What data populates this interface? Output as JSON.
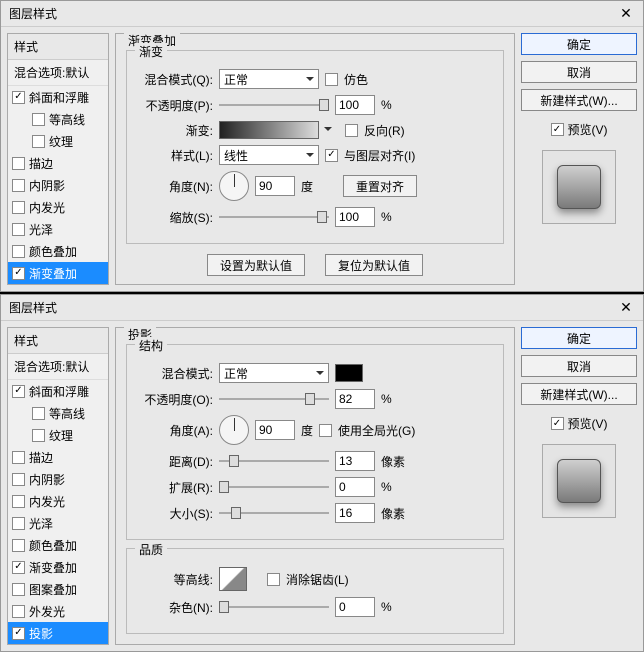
{
  "dialogs": [
    {
      "title": "图层样式",
      "styles_header": "样式",
      "blend_default": "混合选项:默认",
      "style_items": [
        {
          "label": "斜面和浮雕",
          "checked": true,
          "selected": false,
          "indent": false
        },
        {
          "label": "等高线",
          "checked": false,
          "selected": false,
          "indent": true
        },
        {
          "label": "纹理",
          "checked": false,
          "selected": false,
          "indent": true
        },
        {
          "label": "描边",
          "checked": false,
          "selected": false,
          "indent": false
        },
        {
          "label": "内阴影",
          "checked": false,
          "selected": false,
          "indent": false
        },
        {
          "label": "内发光",
          "checked": false,
          "selected": false,
          "indent": false
        },
        {
          "label": "光泽",
          "checked": false,
          "selected": false,
          "indent": false
        },
        {
          "label": "颜色叠加",
          "checked": false,
          "selected": false,
          "indent": false
        },
        {
          "label": "渐变叠加",
          "checked": true,
          "selected": true,
          "indent": false
        }
      ],
      "panel_title": "渐变叠加",
      "sub_title": "渐变",
      "blend_mode_label": "混合模式(Q):",
      "blend_mode_value": "正常",
      "dither_label": "仿色",
      "opacity_label": "不透明度(P):",
      "opacity_value": "100",
      "pct": "%",
      "gradient_label": "渐变:",
      "reverse_label": "反向(R)",
      "style_label": "样式(L):",
      "style_value": "线性",
      "align_label": "与图层对齐(I)",
      "angle_label": "角度(N):",
      "angle_value": "90",
      "deg": "度",
      "reset_align": "重置对齐",
      "scale_label": "缩放(S):",
      "scale_value": "100",
      "set_default": "设置为默认值",
      "reset_default": "复位为默认值",
      "ok": "确定",
      "cancel": "取消",
      "new_style": "新建样式(W)...",
      "preview_label": "预览(V)"
    },
    {
      "title": "图层样式",
      "styles_header": "样式",
      "blend_default": "混合选项:默认",
      "style_items": [
        {
          "label": "斜面和浮雕",
          "checked": true,
          "selected": false,
          "indent": false
        },
        {
          "label": "等高线",
          "checked": false,
          "selected": false,
          "indent": true
        },
        {
          "label": "纹理",
          "checked": false,
          "selected": false,
          "indent": true
        },
        {
          "label": "描边",
          "checked": false,
          "selected": false,
          "indent": false
        },
        {
          "label": "内阴影",
          "checked": false,
          "selected": false,
          "indent": false
        },
        {
          "label": "内发光",
          "checked": false,
          "selected": false,
          "indent": false
        },
        {
          "label": "光泽",
          "checked": false,
          "selected": false,
          "indent": false
        },
        {
          "label": "颜色叠加",
          "checked": false,
          "selected": false,
          "indent": false
        },
        {
          "label": "渐变叠加",
          "checked": true,
          "selected": false,
          "indent": false
        },
        {
          "label": "图案叠加",
          "checked": false,
          "selected": false,
          "indent": false
        },
        {
          "label": "外发光",
          "checked": false,
          "selected": false,
          "indent": false
        },
        {
          "label": "投影",
          "checked": true,
          "selected": true,
          "indent": false
        }
      ],
      "panel_title": "投影",
      "sub_title": "结构",
      "blend_mode_label": "混合模式:",
      "blend_mode_value": "正常",
      "opacity_label": "不透明度(O):",
      "opacity_value": "82",
      "pct": "%",
      "angle_label": "角度(A):",
      "angle_value": "90",
      "deg": "度",
      "global_light_label": "使用全局光(G)",
      "distance_label": "距离(D):",
      "distance_value": "13",
      "px": "像素",
      "spread_label": "扩展(R):",
      "spread_value": "0",
      "size_label": "大小(S):",
      "size_value": "16",
      "quality_title": "品质",
      "contour_label": "等高线:",
      "antialias_label": "消除锯齿(L)",
      "noise_label": "杂色(N):",
      "noise_value": "0",
      "ok": "确定",
      "cancel": "取消",
      "new_style": "新建样式(W)...",
      "preview_label": "预览(V)"
    }
  ]
}
